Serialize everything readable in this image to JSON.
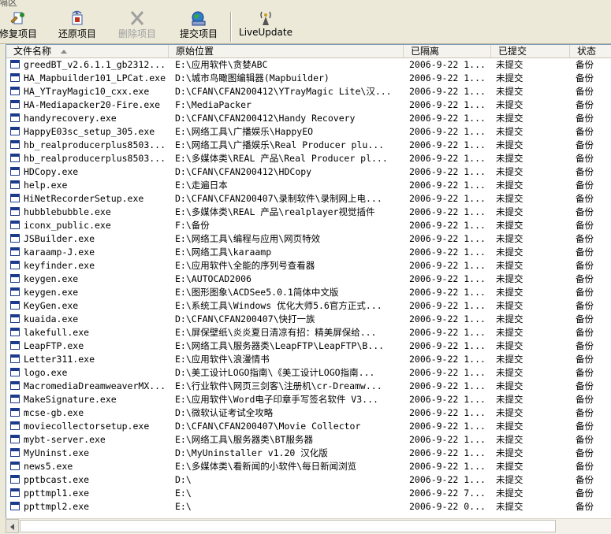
{
  "window": {
    "title_fragment": "隔区"
  },
  "toolbar": {
    "restore_label": "修复项目",
    "recover_label": "还原项目",
    "delete_label": "删除项目",
    "submit_label": "提交项目",
    "liveupdate_label": "LiveUpdate"
  },
  "columns": {
    "name": "文件名称",
    "location": "原始位置",
    "quarantined": "已隔离",
    "submitted": "已提交",
    "status": "状态"
  },
  "rows": [
    {
      "name": "greedBT_v2.6.1.1_gb2312...",
      "location": "E:\\应用软件\\贪婪ABC",
      "quarantined": "2006-9-22 1...",
      "submitted": "未提交",
      "status": "备份"
    },
    {
      "name": "HA_Mapbuilder101_LPCat.exe",
      "location": "D:\\城市鸟瞰图编辑器(Mapbuilder)",
      "quarantined": "2006-9-22 1...",
      "submitted": "未提交",
      "status": "备份"
    },
    {
      "name": "HA_YTrayMagic10_cxx.exe",
      "location": "D:\\CFAN\\CFAN200412\\YTrayMagic Lite\\汉...",
      "quarantined": "2006-9-22 1...",
      "submitted": "未提交",
      "status": "备份"
    },
    {
      "name": "HA-Mediapacker20-Fire.exe",
      "location": "F:\\MediaPacker",
      "quarantined": "2006-9-22 1...",
      "submitted": "未提交",
      "status": "备份"
    },
    {
      "name": "handyrecovery.exe",
      "location": "D:\\CFAN\\CFAN200412\\Handy Recovery",
      "quarantined": "2006-9-22 1...",
      "submitted": "未提交",
      "status": "备份"
    },
    {
      "name": "HappyE03sc_setup_305.exe",
      "location": "E:\\网络工具\\广播娱乐\\HappyEO",
      "quarantined": "2006-9-22 1...",
      "submitted": "未提交",
      "status": "备份"
    },
    {
      "name": "hb_realproducerplus8503...",
      "location": "E:\\网络工具\\广播娱乐\\Real Producer plu...",
      "quarantined": "2006-9-22 1...",
      "submitted": "未提交",
      "status": "备份"
    },
    {
      "name": "hb_realproducerplus8503...",
      "location": "E:\\多媒体类\\REAL 产品\\Real Producer pl...",
      "quarantined": "2006-9-22 1...",
      "submitted": "未提交",
      "status": "备份"
    },
    {
      "name": "HDCopy.exe",
      "location": "D:\\CFAN\\CFAN200412\\HDCopy",
      "quarantined": "2006-9-22 1...",
      "submitted": "未提交",
      "status": "备份"
    },
    {
      "name": "help.exe",
      "location": "E:\\走遍日本",
      "quarantined": "2006-9-22 1...",
      "submitted": "未提交",
      "status": "备份"
    },
    {
      "name": "HiNetRecorderSetup.exe",
      "location": "D:\\CFAN\\CFAN200407\\录制软件\\录制网上电...",
      "quarantined": "2006-9-22 1...",
      "submitted": "未提交",
      "status": "备份"
    },
    {
      "name": "hubblebubble.exe",
      "location": "E:\\多媒体类\\REAL 产品\\realplayer视觉插件",
      "quarantined": "2006-9-22 1...",
      "submitted": "未提交",
      "status": "备份"
    },
    {
      "name": "iconx_public.exe",
      "location": "F:\\备份",
      "quarantined": "2006-9-22 1...",
      "submitted": "未提交",
      "status": "备份"
    },
    {
      "name": "JSBuilder.exe",
      "location": "E:\\网络工具\\编程与应用\\网页特效",
      "quarantined": "2006-9-22 1...",
      "submitted": "未提交",
      "status": "备份"
    },
    {
      "name": "karaamp-J.exe",
      "location": "E:\\网络工具\\karaamp",
      "quarantined": "2006-9-22 1...",
      "submitted": "未提交",
      "status": "备份"
    },
    {
      "name": "keyfinder.exe",
      "location": "E:\\应用软件\\全能的序列号查看器",
      "quarantined": "2006-9-22 1...",
      "submitted": "未提交",
      "status": "备份"
    },
    {
      "name": "keygen.exe",
      "location": "E:\\AUTOCAD2006",
      "quarantined": "2006-9-22 1...",
      "submitted": "未提交",
      "status": "备份"
    },
    {
      "name": "keygen.exe",
      "location": "E:\\图形图象\\ACDSee5.0.1简体中文版",
      "quarantined": "2006-9-22 1...",
      "submitted": "未提交",
      "status": "备份"
    },
    {
      "name": "KeyGen.exe",
      "location": "E:\\系统工具\\Windows 优化大师5.6官方正式...",
      "quarantined": "2006-9-22 1...",
      "submitted": "未提交",
      "status": "备份"
    },
    {
      "name": "kuaida.exe",
      "location": "D:\\CFAN\\CFAN200407\\快打一族",
      "quarantined": "2006-9-22 1...",
      "submitted": "未提交",
      "status": "备份"
    },
    {
      "name": "lakefull.exe",
      "location": "E:\\屏保壁纸\\炎炎夏日清凉有招：精美屏保给...",
      "quarantined": "2006-9-22 1...",
      "submitted": "未提交",
      "status": "备份"
    },
    {
      "name": "LeapFTP.exe",
      "location": "E:\\网络工具\\服务器类\\LeapFTP\\LeapFTP\\B...",
      "quarantined": "2006-9-22 1...",
      "submitted": "未提交",
      "status": "备份"
    },
    {
      "name": "Letter311.exe",
      "location": "E:\\应用软件\\浪漫情书",
      "quarantined": "2006-9-22 1...",
      "submitted": "未提交",
      "status": "备份"
    },
    {
      "name": "logo.exe",
      "location": "D:\\美工设计LOGO指南\\《美工设计LOGO指南...",
      "quarantined": "2006-9-22 1...",
      "submitted": "未提交",
      "status": "备份"
    },
    {
      "name": "MacromediaDreamweaverMX...",
      "location": "E:\\行业软件\\网页三剑客\\注册机\\cr-Dreamw...",
      "quarantined": "2006-9-22 1...",
      "submitted": "未提交",
      "status": "备份"
    },
    {
      "name": "MakeSignature.exe",
      "location": "E:\\应用软件\\Word电子印章手写签名软件 V3...",
      "quarantined": "2006-9-22 1...",
      "submitted": "未提交",
      "status": "备份"
    },
    {
      "name": "mcse-gb.exe",
      "location": "D:\\微软认证考试全攻略",
      "quarantined": "2006-9-22 1...",
      "submitted": "未提交",
      "status": "备份"
    },
    {
      "name": "moviecollectorsetup.exe",
      "location": "D:\\CFAN\\CFAN200407\\Movie Collector",
      "quarantined": "2006-9-22 1...",
      "submitted": "未提交",
      "status": "备份"
    },
    {
      "name": "mybt-server.exe",
      "location": "E:\\网络工具\\服务器类\\BT服务器",
      "quarantined": "2006-9-22 1...",
      "submitted": "未提交",
      "status": "备份"
    },
    {
      "name": "MyUninst.exe",
      "location": "D:\\MyUninstaller v1.20 汉化版",
      "quarantined": "2006-9-22 1...",
      "submitted": "未提交",
      "status": "备份"
    },
    {
      "name": "news5.exe",
      "location": "E:\\多媒体类\\看新闻的小软件\\每日新闻浏览",
      "quarantined": "2006-9-22 1...",
      "submitted": "未提交",
      "status": "备份"
    },
    {
      "name": "pptbcast.exe",
      "location": "D:\\",
      "quarantined": "2006-9-22 1...",
      "submitted": "未提交",
      "status": "备份"
    },
    {
      "name": "ppttmpl1.exe",
      "location": "E:\\",
      "quarantined": "2006-9-22 7...",
      "submitted": "未提交",
      "status": "备份"
    },
    {
      "name": "ppttmpl2.exe",
      "location": "E:\\",
      "quarantined": "2006-9-22 0...",
      "submitted": "未提交",
      "status": "备份"
    }
  ],
  "colors": {
    "header_bg": "#f4f3ee",
    "window_bg": "#ece9d8",
    "icon_blue": "#1c3a8c"
  }
}
